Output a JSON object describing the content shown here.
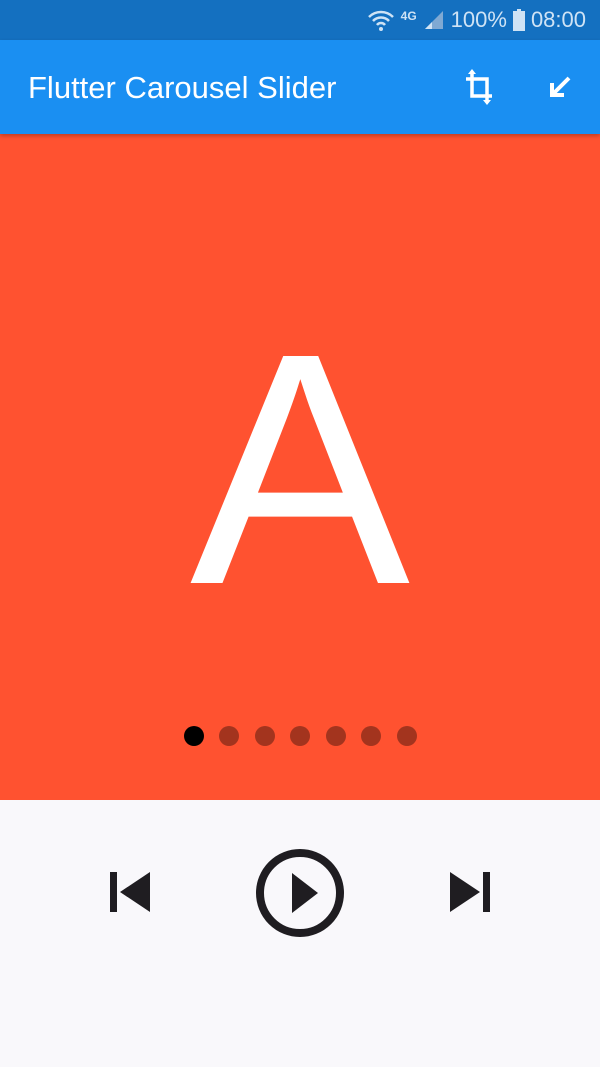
{
  "status_bar": {
    "battery": "100%",
    "time": "08:00",
    "network": "4G",
    "icons": [
      "wifi-icon",
      "signal-icon",
      "battery-icon"
    ]
  },
  "app_bar": {
    "title": "Flutter Carousel Slider",
    "actions": [
      "crop-rotate-icon",
      "arrow-down-left-icon"
    ]
  },
  "carousel": {
    "current_label": "A",
    "background": "#ff5230",
    "page_count": 7,
    "current_index": 0,
    "active_dot_color": "#000000",
    "inactive_dot_color": "#a3341e"
  },
  "controls": {
    "icons": [
      "skip-previous-icon",
      "play-circle-icon",
      "skip-next-icon"
    ]
  }
}
